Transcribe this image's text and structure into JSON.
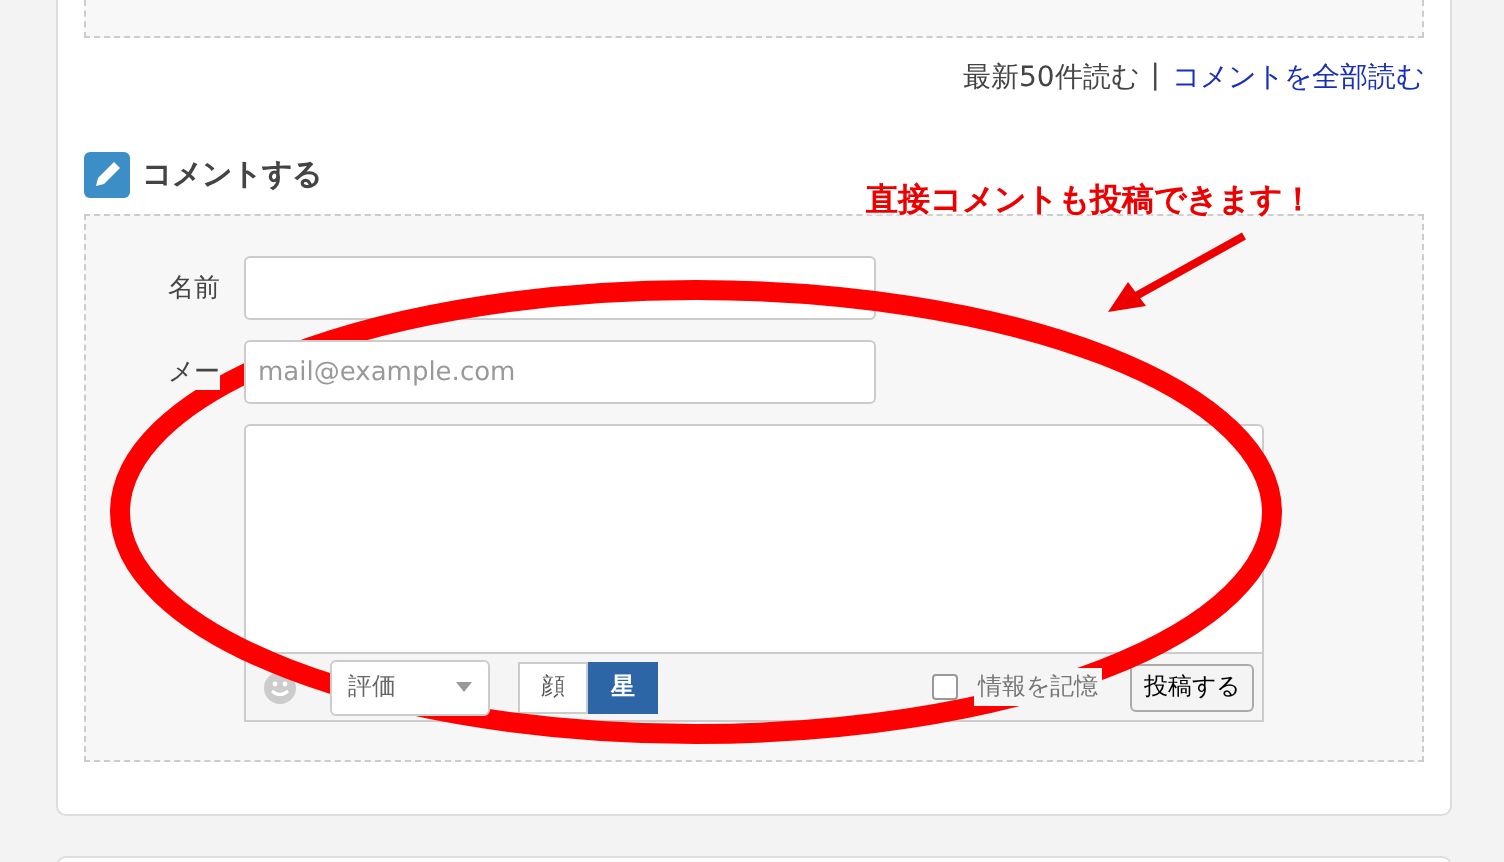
{
  "comment_links": {
    "recent": "最新50件読む",
    "separator": "|",
    "all": "コメントを全部読む"
  },
  "comment_form": {
    "heading": "コメントする",
    "fields": [
      {
        "label": "名前"
      },
      {
        "label": "メー",
        "placeholder": "mail@example.com"
      }
    ],
    "toolbar": {
      "rating_select": "評価",
      "tabs": [
        {
          "label": "顔",
          "selected": false
        },
        {
          "label": "星",
          "selected": true
        }
      ],
      "remember": {
        "label": "情報を記憶",
        "checked": false
      },
      "submit": "投稿する"
    }
  },
  "annotation": {
    "text": "直接コメントも投稿できます！"
  }
}
